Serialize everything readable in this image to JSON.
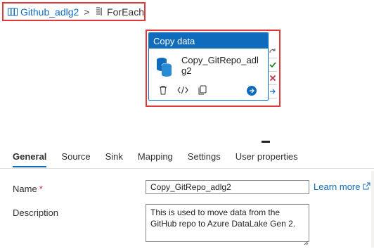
{
  "breadcrumb": {
    "parent": "Github_adlg2",
    "separator": ">",
    "current": "ForEach"
  },
  "activity": {
    "type_label": "Copy data",
    "name": "Copy_GitRepo_adlg2",
    "icons": [
      "database-icon",
      "delete-icon",
      "code-icon",
      "clone-icon",
      "arrow-right-circle-icon"
    ],
    "side_icons": [
      "redo-icon",
      "check-icon",
      "close-x-icon",
      "arrow-right-icon"
    ]
  },
  "tabs": [
    {
      "label": "General",
      "active": true
    },
    {
      "label": "Source"
    },
    {
      "label": "Sink"
    },
    {
      "label": "Mapping"
    },
    {
      "label": "Settings"
    },
    {
      "label": "User properties"
    }
  ],
  "form": {
    "name_label": "Name",
    "required_mark": "*",
    "name_value": "Copy_GitRepo_adlg2",
    "learn_more": "Learn more",
    "description_label": "Description",
    "description_value": "This is used to move data from the GitHub repo to Azure DataLake Gen 2."
  },
  "colors": {
    "accent": "#0f6cbd",
    "highlight_border": "#e03a3a",
    "success": "#107c10",
    "error": "#c4314b"
  }
}
